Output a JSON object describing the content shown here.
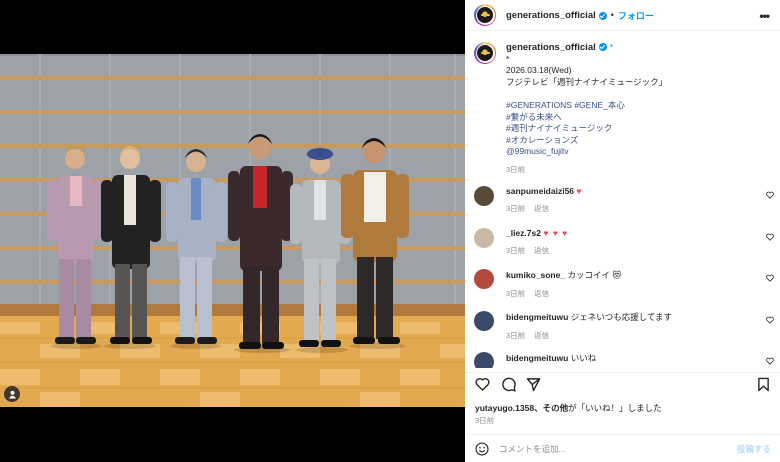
{
  "header": {
    "username": "generations_official",
    "separator": "•",
    "follow_label": "フォロー",
    "more_icon": "more-horizontal-icon"
  },
  "caption": {
    "username": "generations_official",
    "star": "*",
    "bullet": "*",
    "lines": [
      "2026.03.18(Wed)",
      "フジテレビ「週刊ナイナイミュージック」"
    ],
    "tags": [
      "#GENERATIONS #GENE_本心",
      "#繋がる未来へ",
      "#週刊ナイナイミュージック",
      "#オカレーションズ",
      "@99music_fujitv"
    ],
    "time": "3日前"
  },
  "comments": [
    {
      "username": "sanpumeidaizi56",
      "text": "",
      "emoji": "♥",
      "time": "3日前",
      "reply": "返信",
      "avatar_color": "#5a4a3a"
    },
    {
      "username": "_liez.7s2",
      "text": "",
      "emoji": "♥ ♥ ♥",
      "time": "3日前",
      "reply": "返信",
      "avatar_color": "#c9b8a6"
    },
    {
      "username": "kumiko_sone_",
      "text": "カッコイイ",
      "emoji": "😻",
      "time": "3日前",
      "reply": "返信",
      "avatar_color": "#b44a3c"
    },
    {
      "username": "bidengmeituwu",
      "text": "ジェネいつも応援してます",
      "emoji": "",
      "time": "3日前",
      "reply": "返信",
      "avatar_color": "#3b4a6b"
    },
    {
      "username": "bidengmeituwu",
      "text": "いいね",
      "emoji": "",
      "time": "",
      "reply": "",
      "avatar_color": "#3b4a6b"
    }
  ],
  "likes": {
    "user": "yutayugo.1358",
    "rest": "、その他",
    "suffix": "が「いいね！」しました"
  },
  "post_time": "3日前",
  "comment_input": {
    "placeholder": "コメントを追加...",
    "post_label": "投稿する"
  },
  "colors": {
    "accent": "#0095f6",
    "link": "#385185",
    "like": "#ed4956"
  }
}
